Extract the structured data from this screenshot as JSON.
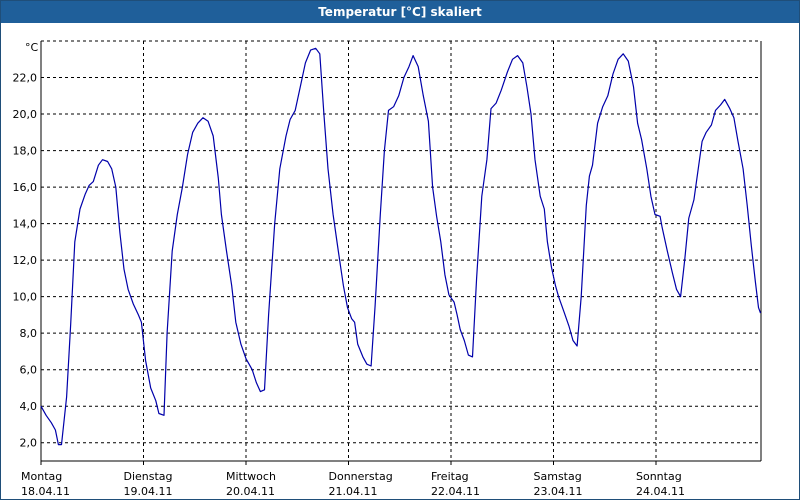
{
  "window": {
    "title": "Temperatur [°C] skaliert"
  },
  "chart_data": {
    "type": "line",
    "title": "Temperatur [°C] skaliert",
    "ylabel": "°C",
    "xlabel": "",
    "ylim": [
      1.0,
      24.0
    ],
    "y_ticks": [
      2.0,
      4.0,
      6.0,
      8.0,
      10.0,
      12.0,
      14.0,
      16.0,
      18.0,
      20.0,
      22.0
    ],
    "y_tick_labels": [
      "2,0",
      "4,0",
      "6,0",
      "8,0",
      "10,0",
      "12,0",
      "14,0",
      "16,0",
      "18,0",
      "20,0",
      "22,0"
    ],
    "x_range": [
      0,
      7.1
    ],
    "grid": true,
    "x_ticks": [
      {
        "day": "Montag",
        "date": "18.04.11",
        "x": 0
      },
      {
        "day": "Dienstag",
        "date": "19.04.11",
        "x": 1
      },
      {
        "day": "Mittwoch",
        "date": "20.04.11",
        "x": 2
      },
      {
        "day": "Donnerstag",
        "date": "21.04.11",
        "x": 3
      },
      {
        "day": "Freitag",
        "date": "22.04.11",
        "x": 4
      },
      {
        "day": "Samstag",
        "date": "23.04.11",
        "x": 5
      },
      {
        "day": "Sonntag",
        "date": "24.04.11",
        "x": 6
      }
    ],
    "series": [
      {
        "color": "#0000aa",
        "points": [
          [
            0.0,
            4.0
          ],
          [
            0.05,
            3.5
          ],
          [
            0.1,
            3.1
          ],
          [
            0.14,
            2.7
          ],
          [
            0.17,
            1.9
          ],
          [
            0.2,
            1.9
          ],
          [
            0.25,
            4.5
          ],
          [
            0.29,
            8.5
          ],
          [
            0.33,
            13.0
          ],
          [
            0.38,
            14.8
          ],
          [
            0.43,
            15.6
          ],
          [
            0.47,
            16.1
          ],
          [
            0.51,
            16.3
          ],
          [
            0.56,
            17.2
          ],
          [
            0.6,
            17.5
          ],
          [
            0.65,
            17.4
          ],
          [
            0.69,
            17.0
          ],
          [
            0.73,
            16.0
          ],
          [
            0.77,
            13.5
          ],
          [
            0.81,
            11.5
          ],
          [
            0.85,
            10.4
          ],
          [
            0.9,
            9.6
          ],
          [
            0.95,
            9.0
          ],
          [
            0.98,
            8.6
          ],
          [
            1.02,
            6.5
          ],
          [
            1.07,
            5.0
          ],
          [
            1.12,
            4.3
          ],
          [
            1.15,
            3.6
          ],
          [
            1.2,
            3.5
          ],
          [
            1.23,
            8.0
          ],
          [
            1.28,
            12.5
          ],
          [
            1.33,
            14.5
          ],
          [
            1.38,
            16.0
          ],
          [
            1.43,
            17.8
          ],
          [
            1.48,
            19.0
          ],
          [
            1.53,
            19.5
          ],
          [
            1.58,
            19.8
          ],
          [
            1.63,
            19.6
          ],
          [
            1.68,
            18.8
          ],
          [
            1.73,
            16.5
          ],
          [
            1.76,
            14.5
          ],
          [
            1.81,
            12.5
          ],
          [
            1.86,
            10.6
          ],
          [
            1.9,
            8.6
          ],
          [
            1.95,
            7.4
          ],
          [
            2.0,
            6.6
          ],
          [
            2.06,
            6.0
          ],
          [
            2.1,
            5.3
          ],
          [
            2.14,
            4.8
          ],
          [
            2.18,
            4.9
          ],
          [
            2.22,
            9.0
          ],
          [
            2.28,
            14.0
          ],
          [
            2.33,
            17.0
          ],
          [
            2.39,
            18.8
          ],
          [
            2.43,
            19.7
          ],
          [
            2.48,
            20.2
          ],
          [
            2.53,
            21.5
          ],
          [
            2.58,
            22.8
          ],
          [
            2.63,
            23.5
          ],
          [
            2.68,
            23.6
          ],
          [
            2.72,
            23.3
          ],
          [
            2.76,
            20.0
          ],
          [
            2.8,
            17.0
          ],
          [
            2.85,
            14.5
          ],
          [
            2.9,
            12.5
          ],
          [
            2.95,
            10.6
          ],
          [
            2.99,
            9.4
          ],
          [
            3.03,
            8.8
          ],
          [
            3.06,
            8.6
          ],
          [
            3.09,
            7.4
          ],
          [
            3.14,
            6.7
          ],
          [
            3.18,
            6.3
          ],
          [
            3.22,
            6.2
          ],
          [
            3.26,
            9.5
          ],
          [
            3.31,
            14.5
          ],
          [
            3.35,
            18.0
          ],
          [
            3.39,
            20.2
          ],
          [
            3.44,
            20.4
          ],
          [
            3.49,
            21.0
          ],
          [
            3.54,
            22.0
          ],
          [
            3.59,
            22.6
          ],
          [
            3.63,
            23.2
          ],
          [
            3.68,
            22.6
          ],
          [
            3.73,
            21.0
          ],
          [
            3.78,
            19.6
          ],
          [
            3.82,
            16.0
          ],
          [
            3.86,
            14.4
          ],
          [
            3.9,
            13.0
          ],
          [
            3.94,
            11.2
          ],
          [
            3.98,
            10.1
          ],
          [
            4.03,
            9.7
          ],
          [
            4.06,
            9.0
          ],
          [
            4.09,
            8.2
          ],
          [
            4.13,
            7.6
          ],
          [
            4.17,
            6.8
          ],
          [
            4.21,
            6.7
          ],
          [
            4.25,
            11.0
          ],
          [
            4.3,
            15.5
          ],
          [
            4.35,
            17.5
          ],
          [
            4.39,
            20.3
          ],
          [
            4.44,
            20.6
          ],
          [
            4.49,
            21.3
          ],
          [
            4.55,
            22.3
          ],
          [
            4.6,
            23.0
          ],
          [
            4.65,
            23.2
          ],
          [
            4.7,
            22.8
          ],
          [
            4.74,
            21.5
          ],
          [
            4.78,
            20.0
          ],
          [
            4.82,
            17.5
          ],
          [
            4.87,
            15.5
          ],
          [
            4.91,
            14.8
          ],
          [
            4.94,
            13.0
          ],
          [
            4.98,
            11.6
          ],
          [
            5.02,
            10.6
          ],
          [
            5.05,
            10.0
          ],
          [
            5.1,
            9.2
          ],
          [
            5.15,
            8.4
          ],
          [
            5.19,
            7.6
          ],
          [
            5.23,
            7.3
          ],
          [
            5.27,
            10.0
          ],
          [
            5.32,
            15.0
          ],
          [
            5.35,
            16.6
          ],
          [
            5.38,
            17.2
          ],
          [
            5.43,
            19.5
          ],
          [
            5.48,
            20.4
          ],
          [
            5.53,
            21.0
          ],
          [
            5.58,
            22.2
          ],
          [
            5.63,
            23.0
          ],
          [
            5.68,
            23.3
          ],
          [
            5.73,
            22.9
          ],
          [
            5.78,
            21.5
          ],
          [
            5.82,
            19.5
          ],
          [
            5.86,
            18.6
          ],
          [
            5.91,
            17.0
          ],
          [
            5.95,
            15.5
          ],
          [
            5.99,
            14.5
          ],
          [
            6.04,
            14.4
          ],
          [
            6.06,
            13.8
          ],
          [
            6.11,
            12.5
          ],
          [
            6.16,
            11.3
          ],
          [
            6.2,
            10.4
          ],
          [
            6.24,
            10.0
          ],
          [
            6.28,
            12.0
          ],
          [
            6.32,
            14.3
          ],
          [
            6.37,
            15.3
          ],
          [
            6.42,
            17.3
          ],
          [
            6.45,
            18.5
          ],
          [
            6.49,
            19.0
          ],
          [
            6.54,
            19.4
          ],
          [
            6.58,
            20.2
          ],
          [
            6.63,
            20.5
          ],
          [
            6.67,
            20.8
          ],
          [
            6.72,
            20.3
          ],
          [
            6.76,
            19.8
          ],
          [
            6.8,
            18.5
          ],
          [
            6.85,
            17.0
          ],
          [
            6.89,
            15.0
          ],
          [
            6.93,
            12.8
          ],
          [
            6.97,
            10.8
          ],
          [
            7.0,
            9.4
          ],
          [
            7.02,
            9.1
          ]
        ]
      }
    ]
  }
}
